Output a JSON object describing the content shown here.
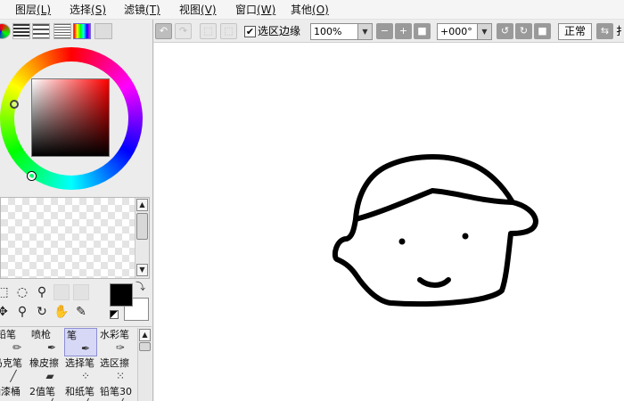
{
  "menu": [
    {
      "label": "图层",
      "accel": "(L)"
    },
    {
      "label": "选择",
      "accel": "(S)"
    },
    {
      "label": "滤镜",
      "accel": "(T)"
    },
    {
      "label": "视图",
      "accel": "(V)"
    },
    {
      "label": "窗口",
      "accel": "(W)"
    },
    {
      "label": "其他",
      "accel": "(O)"
    }
  ],
  "toolbar": {
    "selection_edge_label": "选区边缘",
    "selection_edge_checked": true,
    "zoom_value": "100%",
    "rotation_value": "+000°",
    "blend_mode_label": "正常",
    "trailing_label": "扌"
  },
  "colors": {
    "foreground": "#000000",
    "background": "#ffffff"
  },
  "tools": [
    {
      "name": "rect-select",
      "icon": "dashed-rect-icon"
    },
    {
      "name": "lasso",
      "icon": "lasso-icon"
    },
    {
      "name": "magic-wand",
      "icon": "magic-wand-icon"
    },
    {
      "name": "move",
      "icon": "move-icon"
    },
    {
      "name": "zoom",
      "icon": "magnifier-icon"
    },
    {
      "name": "rotate",
      "icon": "rotate-icon"
    },
    {
      "name": "hand",
      "icon": "hand-icon"
    },
    {
      "name": "eyedropper",
      "icon": "eyedropper-icon"
    }
  ],
  "brushes": [
    {
      "label": "铅笔",
      "icon": "pencil-icon",
      "selected": false
    },
    {
      "label": "喷枪",
      "icon": "airbrush-icon",
      "selected": false
    },
    {
      "label": "笔",
      "icon": "pen-icon",
      "selected": true
    },
    {
      "label": "水彩笔",
      "icon": "watercolor-icon",
      "selected": false
    },
    {
      "label": "马克笔",
      "icon": "marker-icon",
      "selected": false
    },
    {
      "label": "橡皮擦",
      "icon": "eraser-icon",
      "selected": false
    },
    {
      "label": "选择笔",
      "icon": "selection-pen-icon",
      "selected": false
    },
    {
      "label": "选区擦",
      "icon": "selection-eraser-icon",
      "selected": false
    },
    {
      "label": "油漆桶",
      "icon": "bucket-icon",
      "selected": false
    },
    {
      "label": "2值笔",
      "icon": "binary-pen-icon",
      "selected": false
    },
    {
      "label": "和纸笔",
      "icon": "washi-pen-icon",
      "selected": false
    },
    {
      "label": "铅笔30",
      "icon": "pencil30-icon",
      "selected": false
    }
  ]
}
